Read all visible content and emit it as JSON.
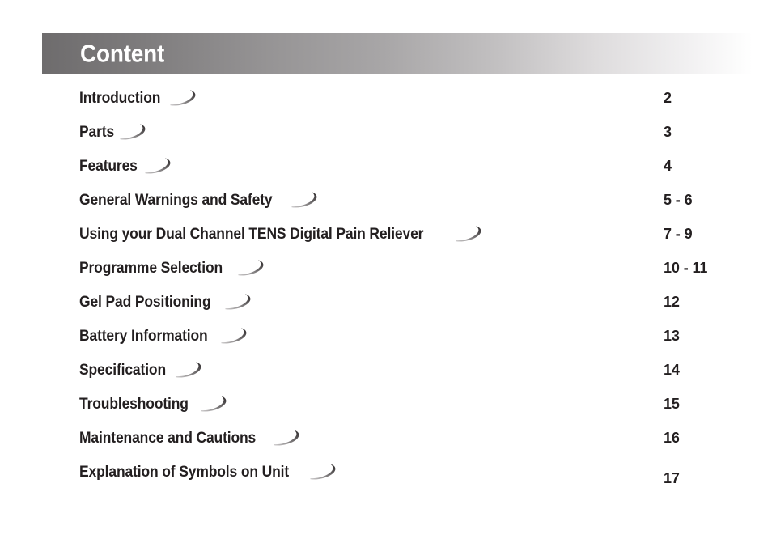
{
  "document": {
    "header": {
      "title": "Content",
      "title_color": "#ffffff",
      "band_gradient_start": "#6e6c6d",
      "band_gradient_end": "#ffffff"
    },
    "text_color": "#231f20",
    "background_color": "#ffffff",
    "ornament_icon": "swoosh-icon",
    "entries": [
      {
        "label": "Introduction",
        "page": "2"
      },
      {
        "label": "Parts",
        "page": "3"
      },
      {
        "label": "Features",
        "page": "4"
      },
      {
        "label": "General Warnings and Safety",
        "page": "5 - 6"
      },
      {
        "label": "Using your Dual Channel TENS Digital Pain Reliever",
        "page": "7 - 9"
      },
      {
        "label": "Programme Selection",
        "page": "10 - 11"
      },
      {
        "label": "Gel Pad Positioning",
        "page": "12"
      },
      {
        "label": "Battery Information",
        "page": "13"
      },
      {
        "label": "Specification",
        "page": "14"
      },
      {
        "label": "Troubleshooting",
        "page": "15"
      },
      {
        "label": "Maintenance and Cautions",
        "page": "16"
      },
      {
        "label": "Explanation of Symbols on Unit",
        "page": "17"
      }
    ]
  }
}
